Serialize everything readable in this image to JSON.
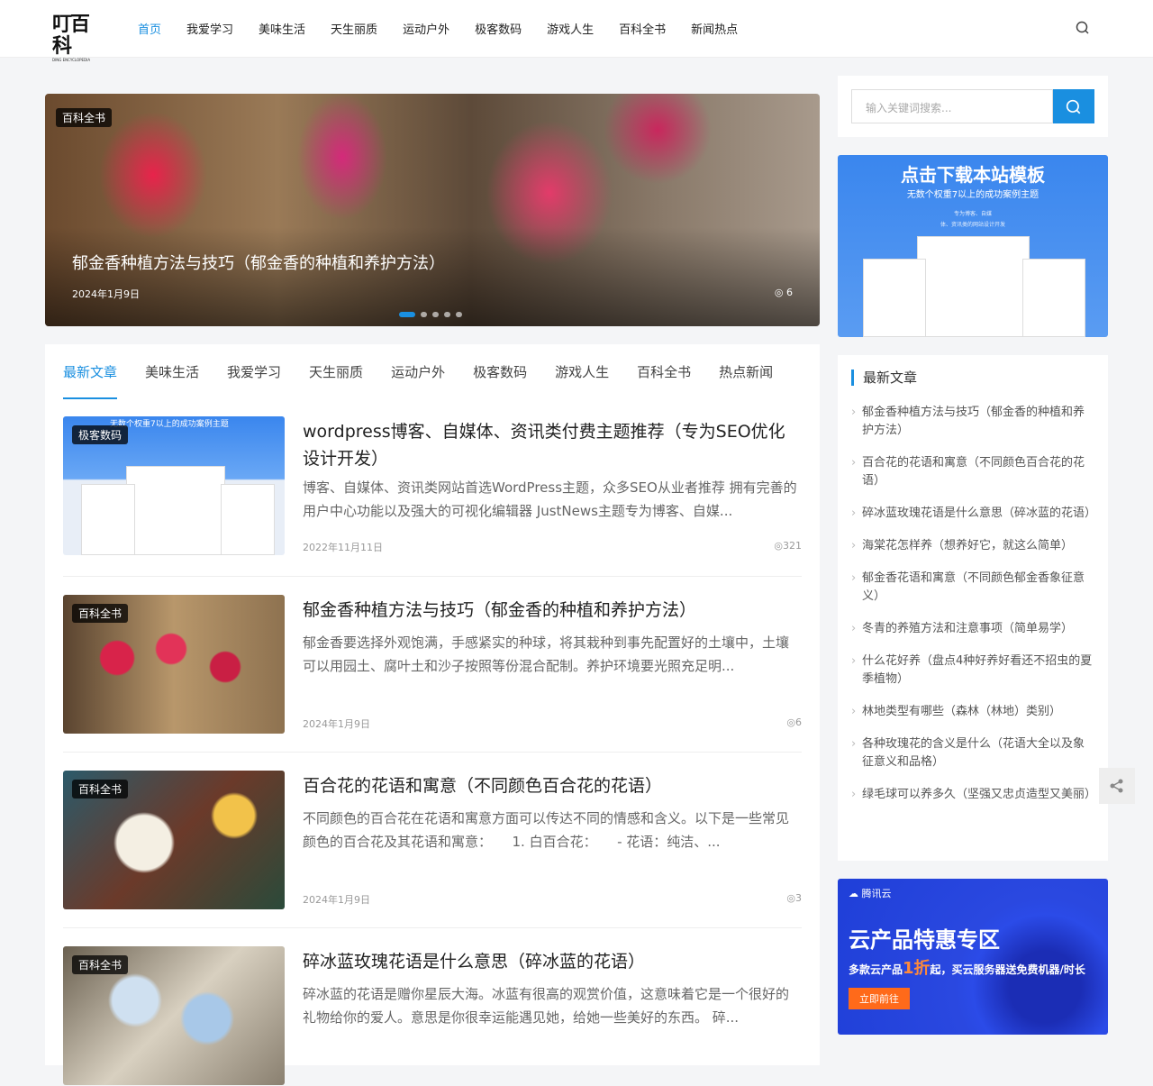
{
  "header": {
    "logo_text": "叮百科",
    "logo_sub": "DING ENCYCLOPEDIA",
    "nav": [
      "首页",
      "我爱学习",
      "美味生活",
      "天生丽质",
      "运动户外",
      "极客数码",
      "游戏人生",
      "百科全书",
      "新闻热点"
    ]
  },
  "slider": {
    "badge": "百科全书",
    "title": "郁金香种植方法与技巧（郁金香的种植和养护方法）",
    "date": "2024年1月9日",
    "views": "6"
  },
  "tabs": [
    "最新文章",
    "美味生活",
    "我爱学习",
    "天生丽质",
    "运动户外",
    "极客数码",
    "游戏人生",
    "百科全书",
    "热点新闻"
  ],
  "articles": [
    {
      "badge": "极客数码",
      "title": "wordpress博客、自媒体、资讯类付费主题推荐（专为SEO优化设计开发）",
      "excerpt": "博客、自媒体、资讯类网站首选WordPress主题，众多SEO从业者推荐 拥有完善的用户中心功能以及强大的可视化编辑器 JustNews主题专为博客、自媒...",
      "date": "2022年11月11日",
      "views": "321",
      "thumb_text": "无数个权重7以上的成功案例主题"
    },
    {
      "badge": "百科全书",
      "title": "郁金香种植方法与技巧（郁金香的种植和养护方法）",
      "excerpt": "郁金香要选择外观饱满，手感紧实的种球，将其栽种到事先配置好的土壤中，土壤可以用园土、腐叶土和沙子按照等份混合配制。养护环境要光照充足明...",
      "date": "2024年1月9日",
      "views": "6"
    },
    {
      "badge": "百科全书",
      "title": "百合花的花语和寓意（不同颜色百合花的花语）",
      "excerpt": "不同颜色的百合花在花语和寓意方面可以传达不同的情感和含义。以下是一些常见颜色的百合花及其花语和寓意：　　1. 白百合花：　　- 花语：纯洁、...",
      "date": "2024年1月9日",
      "views": "3"
    },
    {
      "badge": "百科全书",
      "title": "碎冰蓝玫瑰花语是什么意思（碎冰蓝的花语）",
      "excerpt": "碎冰蓝的花语是赠你星辰大海。冰蓝有很高的观赏价值，这意味着它是一个很好的礼物给你的爱人。意思是你很幸运能遇见她，给她一些美好的东西。 碎...",
      "date": "",
      "views": ""
    }
  ],
  "sidebar": {
    "search_placeholder": "输入关键词搜索...",
    "banner": {
      "title": "点击下载本站模板",
      "subtitle": "无数个权重7以上的成功案例主题",
      "desc1": "专为博客、自媒",
      "desc2": "体、资讯类的网站设计开发"
    },
    "latest_title": "最新文章",
    "latest": [
      "郁金香种植方法与技巧（郁金香的种植和养护方法）",
      "百合花的花语和寓意（不同颜色百合花的花语）",
      "碎冰蓝玫瑰花语是什么意思（碎冰蓝的花语）",
      "海棠花怎样养（想养好它，就这么简单）",
      "郁金香花语和寓意（不同颜色郁金香象征意义）",
      "冬青的养殖方法和注意事项（简单易学）",
      "什么花好养（盘点4种好养好看还不招虫的夏季植物）",
      "林地类型有哪些（森林（林地）类别）",
      "各种玫瑰花的含义是什么（花语大全以及象征意义和品格）",
      "绿毛球可以养多久（坚强又忠贞造型又美丽）"
    ],
    "ad": {
      "brand": "腾讯云",
      "title": "云产品特惠专区",
      "sub_a": "多款云产品",
      "sub_b": "1折",
      "sub_c": "起，买云服务器送免费机器/时长",
      "cta": "立即前往"
    }
  },
  "colors": {
    "accent": "#1a8fe0"
  }
}
